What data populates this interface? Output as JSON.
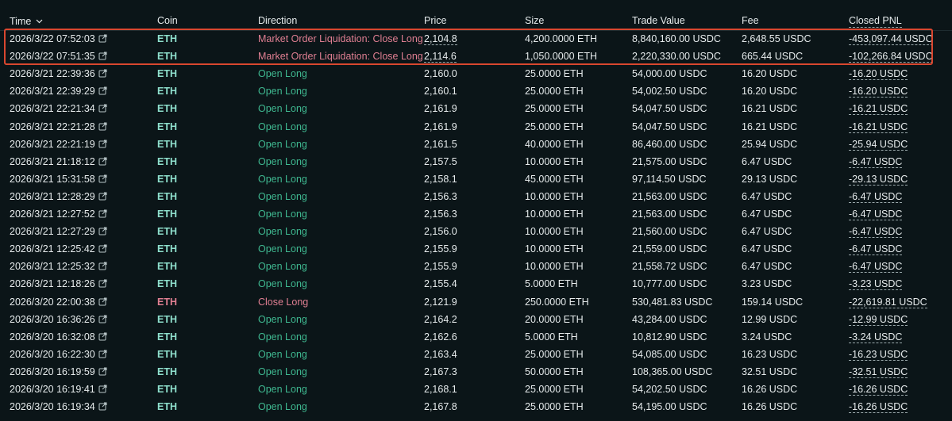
{
  "columns": {
    "time": "Time",
    "coin": "Coin",
    "direction": "Direction",
    "price": "Price",
    "size": "Size",
    "trade_value": "Trade Value",
    "fee": "Fee",
    "closed_pnl": "Closed PNL"
  },
  "icons": {
    "sort": "chevron-down-icon",
    "external": "external-link-icon"
  },
  "colors": {
    "background": "#0b1518",
    "open_long": "#3fb890",
    "close": "#e07f92",
    "coin_long": "#8fe0cd",
    "highlight": "#d9472f"
  },
  "rows": [
    {
      "time": "2026/3/22 07:52:03",
      "coin": "ETH",
      "direction": "Market Order Liquidation: Close Long",
      "price": "2,104.8",
      "size": "4,200.0000 ETH",
      "trade_value": "8,840,160.00 USDC",
      "fee": "2,648.55 USDC",
      "closed_pnl": "-453,097.44 USDC",
      "kind": "close"
    },
    {
      "time": "2026/3/22 07:51:35",
      "coin": "ETH",
      "direction": "Market Order Liquidation: Close Long",
      "price": "2,114.6",
      "size": "1,050.0000 ETH",
      "trade_value": "2,220,330.00 USDC",
      "fee": "665.44 USDC",
      "closed_pnl": "-102,266.84 USDC",
      "kind": "close"
    },
    {
      "time": "2026/3/21 22:39:36",
      "coin": "ETH",
      "direction": "Open Long",
      "price": "2,160.0",
      "size": "25.0000 ETH",
      "trade_value": "54,000.00 USDC",
      "fee": "16.20 USDC",
      "closed_pnl": "-16.20 USDC",
      "kind": "open"
    },
    {
      "time": "2026/3/21 22:39:29",
      "coin": "ETH",
      "direction": "Open Long",
      "price": "2,160.1",
      "size": "25.0000 ETH",
      "trade_value": "54,002.50 USDC",
      "fee": "16.20 USDC",
      "closed_pnl": "-16.20 USDC",
      "kind": "open"
    },
    {
      "time": "2026/3/21 22:21:34",
      "coin": "ETH",
      "direction": "Open Long",
      "price": "2,161.9",
      "size": "25.0000 ETH",
      "trade_value": "54,047.50 USDC",
      "fee": "16.21 USDC",
      "closed_pnl": "-16.21 USDC",
      "kind": "open"
    },
    {
      "time": "2026/3/21 22:21:28",
      "coin": "ETH",
      "direction": "Open Long",
      "price": "2,161.9",
      "size": "25.0000 ETH",
      "trade_value": "54,047.50 USDC",
      "fee": "16.21 USDC",
      "closed_pnl": "-16.21 USDC",
      "kind": "open"
    },
    {
      "time": "2026/3/21 22:21:19",
      "coin": "ETH",
      "direction": "Open Long",
      "price": "2,161.5",
      "size": "40.0000 ETH",
      "trade_value": "86,460.00 USDC",
      "fee": "25.94 USDC",
      "closed_pnl": "-25.94 USDC",
      "kind": "open"
    },
    {
      "time": "2026/3/21 21:18:12",
      "coin": "ETH",
      "direction": "Open Long",
      "price": "2,157.5",
      "size": "10.0000 ETH",
      "trade_value": "21,575.00 USDC",
      "fee": "6.47 USDC",
      "closed_pnl": "-6.47 USDC",
      "kind": "open"
    },
    {
      "time": "2026/3/21 15:31:58",
      "coin": "ETH",
      "direction": "Open Long",
      "price": "2,158.1",
      "size": "45.0000 ETH",
      "trade_value": "97,114.50 USDC",
      "fee": "29.13 USDC",
      "closed_pnl": "-29.13 USDC",
      "kind": "open"
    },
    {
      "time": "2026/3/21 12:28:29",
      "coin": "ETH",
      "direction": "Open Long",
      "price": "2,156.3",
      "size": "10.0000 ETH",
      "trade_value": "21,563.00 USDC",
      "fee": "6.47 USDC",
      "closed_pnl": "-6.47 USDC",
      "kind": "open"
    },
    {
      "time": "2026/3/21 12:27:52",
      "coin": "ETH",
      "direction": "Open Long",
      "price": "2,156.3",
      "size": "10.0000 ETH",
      "trade_value": "21,563.00 USDC",
      "fee": "6.47 USDC",
      "closed_pnl": "-6.47 USDC",
      "kind": "open"
    },
    {
      "time": "2026/3/21 12:27:29",
      "coin": "ETH",
      "direction": "Open Long",
      "price": "2,156.0",
      "size": "10.0000 ETH",
      "trade_value": "21,560.00 USDC",
      "fee": "6.47 USDC",
      "closed_pnl": "-6.47 USDC",
      "kind": "open"
    },
    {
      "time": "2026/3/21 12:25:42",
      "coin": "ETH",
      "direction": "Open Long",
      "price": "2,155.9",
      "size": "10.0000 ETH",
      "trade_value": "21,559.00 USDC",
      "fee": "6.47 USDC",
      "closed_pnl": "-6.47 USDC",
      "kind": "open"
    },
    {
      "time": "2026/3/21 12:25:32",
      "coin": "ETH",
      "direction": "Open Long",
      "price": "2,155.9",
      "size": "10.0000 ETH",
      "trade_value": "21,558.72 USDC",
      "fee": "6.47 USDC",
      "closed_pnl": "-6.47 USDC",
      "kind": "open"
    },
    {
      "time": "2026/3/21 12:18:26",
      "coin": "ETH",
      "direction": "Open Long",
      "price": "2,155.4",
      "size": "5.0000 ETH",
      "trade_value": "10,777.00 USDC",
      "fee": "3.23 USDC",
      "closed_pnl": "-3.23 USDC",
      "kind": "open"
    },
    {
      "time": "2026/3/20 22:00:38",
      "coin": "ETH",
      "direction": "Close Long",
      "price": "2,121.9",
      "size": "250.0000 ETH",
      "trade_value": "530,481.83 USDC",
      "fee": "159.14 USDC",
      "closed_pnl": "-22,619.81 USDC",
      "kind": "close"
    },
    {
      "time": "2026/3/20 16:36:26",
      "coin": "ETH",
      "direction": "Open Long",
      "price": "2,164.2",
      "size": "20.0000 ETH",
      "trade_value": "43,284.00 USDC",
      "fee": "12.99 USDC",
      "closed_pnl": "-12.99 USDC",
      "kind": "open"
    },
    {
      "time": "2026/3/20 16:32:08",
      "coin": "ETH",
      "direction": "Open Long",
      "price": "2,162.6",
      "size": "5.0000 ETH",
      "trade_value": "10,812.90 USDC",
      "fee": "3.24 USDC",
      "closed_pnl": "-3.24 USDC",
      "kind": "open"
    },
    {
      "time": "2026/3/20 16:22:30",
      "coin": "ETH",
      "direction": "Open Long",
      "price": "2,163.4",
      "size": "25.0000 ETH",
      "trade_value": "54,085.00 USDC",
      "fee": "16.23 USDC",
      "closed_pnl": "-16.23 USDC",
      "kind": "open"
    },
    {
      "time": "2026/3/20 16:19:59",
      "coin": "ETH",
      "direction": "Open Long",
      "price": "2,167.3",
      "size": "50.0000 ETH",
      "trade_value": "108,365.00 USDC",
      "fee": "32.51 USDC",
      "closed_pnl": "-32.51 USDC",
      "kind": "open"
    },
    {
      "time": "2026/3/20 16:19:41",
      "coin": "ETH",
      "direction": "Open Long",
      "price": "2,168.1",
      "size": "25.0000 ETH",
      "trade_value": "54,202.50 USDC",
      "fee": "16.26 USDC",
      "closed_pnl": "-16.26 USDC",
      "kind": "open"
    },
    {
      "time": "2026/3/20 16:19:34",
      "coin": "ETH",
      "direction": "Open Long",
      "price": "2,167.8",
      "size": "25.0000 ETH",
      "trade_value": "54,195.00 USDC",
      "fee": "16.26 USDC",
      "closed_pnl": "-16.26 USDC",
      "kind": "open"
    }
  ]
}
